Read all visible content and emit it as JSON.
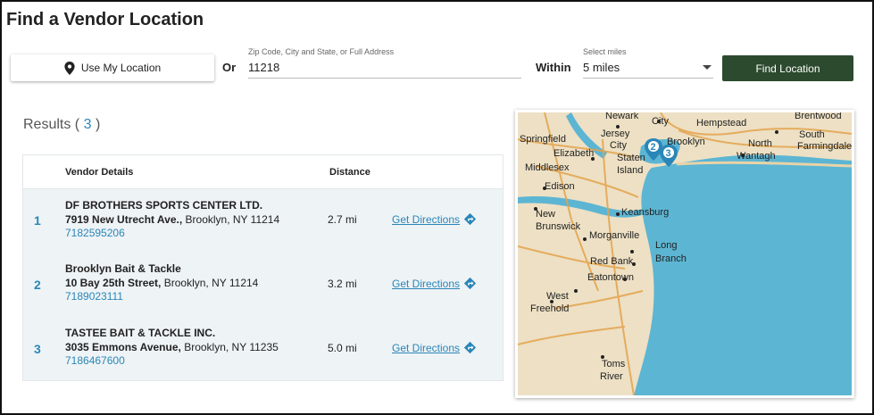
{
  "page": {
    "title": "Find a Vendor Location"
  },
  "search": {
    "use_location_label": "Use My Location",
    "or_label": "Or",
    "zip_caption": "Zip Code, City and State, or Full Address",
    "zip_value": "11218",
    "within_label": "Within",
    "miles_caption": "Select miles",
    "miles_value": "5 miles",
    "find_label": "Find Location"
  },
  "results": {
    "heading_prefix": "Results (",
    "count": "3",
    "heading_suffix": ")",
    "col_vendor": "Vendor Details",
    "col_distance": "Distance",
    "rows": [
      {
        "index": "1",
        "name": "DF BROTHERS SPORTS CENTER LTD.",
        "street": "7919 New Utrecht Ave.,",
        "city": "Brooklyn, NY 11214",
        "phone": "7182595206",
        "distance": "2.7 mi",
        "directions": "Get Directions"
      },
      {
        "index": "2",
        "name": "Brooklyn Bait & Tackle",
        "street": "10 Bay 25th Street,",
        "city": "Brooklyn, NY 11214",
        "phone": "7189023111",
        "distance": "3.2 mi",
        "directions": "Get Directions"
      },
      {
        "index": "3",
        "name": "TASTEE BAIT & TACKLE INC.",
        "street": "3035 Emmons Avenue,",
        "city": "Brooklyn, NY 11235",
        "phone": "7186467600",
        "distance": "5.0 mi",
        "directions": "Get Directions"
      }
    ]
  },
  "map": {
    "labels": [
      "Newark",
      "City",
      "Hempstead",
      "Brentwood",
      "Springfield",
      "Jersey",
      "City",
      "Brooklyn",
      "North",
      "South",
      "Elizabeth",
      "Staten",
      "Island",
      "Wantagh",
      "Farmingdale",
      "Middlesex",
      "Edison",
      "Keansburg",
      "New",
      "Brunswick",
      "Morganville",
      "Long",
      "Branch",
      "Red Bank",
      "Eatontown",
      "West",
      "Freehold",
      "Toms",
      "River"
    ],
    "markers": [
      "2",
      "3"
    ]
  },
  "colors": {
    "accent": "#2a86b8",
    "button_dark": "#2c4a2e",
    "water": "#5cb5d3",
    "land": "#ede0c4"
  }
}
